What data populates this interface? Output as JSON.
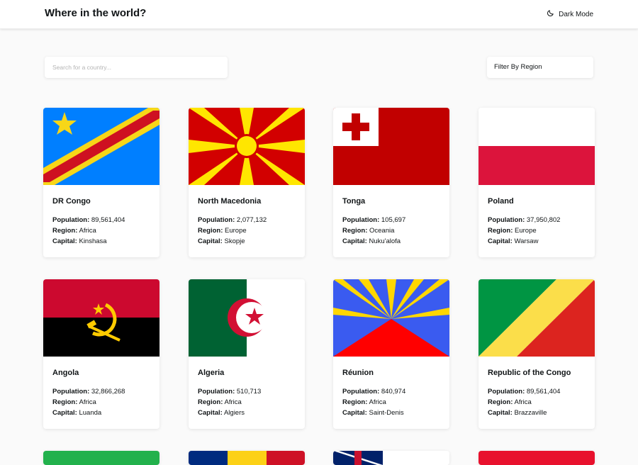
{
  "header": {
    "title": "Where in the world?",
    "mode_label": "Dark Mode"
  },
  "search": {
    "placeholder": "Search for a country..."
  },
  "filter": {
    "label": "Filter By Region"
  },
  "labels": {
    "population": "Population:",
    "region": "Region:",
    "capital": "Capital:"
  },
  "countries": [
    {
      "name": "DR Congo",
      "population": "89,561,404",
      "region": "Africa",
      "capital": "Kinshasa"
    },
    {
      "name": "North Macedonia",
      "population": "2,077,132",
      "region": "Europe",
      "capital": "Skopje"
    },
    {
      "name": "Tonga",
      "population": "105,697",
      "region": "Oceania",
      "capital": "Nuku'alofa"
    },
    {
      "name": "Poland",
      "population": "37,950,802",
      "region": "Europe",
      "capital": "Warsaw"
    },
    {
      "name": "Angola",
      "population": "32,866,268",
      "region": "Africa",
      "capital": "Luanda"
    },
    {
      "name": "Algeria",
      "population": "510,713",
      "region": "Africa",
      "capital": "Algiers"
    },
    {
      "name": "Réunion",
      "population": "840,974",
      "region": "Africa",
      "capital": "Saint-Denis"
    },
    {
      "name": "Republic of the Congo",
      "population": "89,561,404",
      "region": "Africa",
      "capital": "Brazzaville"
    }
  ]
}
